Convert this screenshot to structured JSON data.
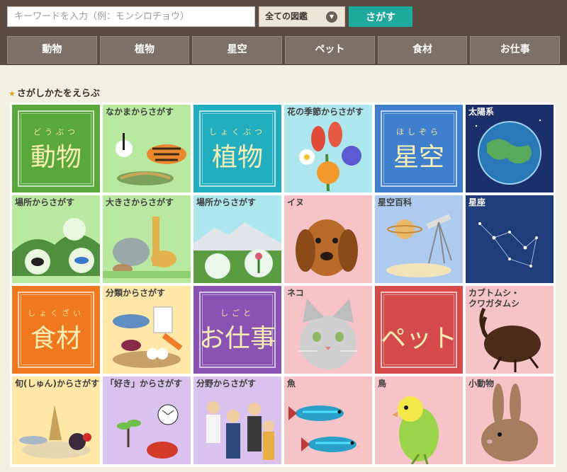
{
  "search": {
    "placeholder": "キーワードを入力（例：モンシロチョウ）",
    "value": ""
  },
  "filter": {
    "selected": "全ての図鑑"
  },
  "search_button": "さがす",
  "nav": [
    "動物",
    "植物",
    "星空",
    "ペット",
    "食材",
    "お仕事"
  ],
  "section_title": "さがしかたをえらぶ",
  "tiles": [
    {
      "kind": "category",
      "ruby": "どうぶつ",
      "title": "動物",
      "bg": "#5aa83c"
    },
    {
      "kind": "topic",
      "label": "なかまからさがす",
      "bg": "#b9e9a0",
      "icon": "animal-group-icon"
    },
    {
      "kind": "category",
      "ruby": "しょくぶつ",
      "title": "植物",
      "bg": "#22aebf"
    },
    {
      "kind": "topic",
      "label": "花の季節からさがす",
      "bg": "#aee6ee",
      "icon": "flower-bouquet-icon"
    },
    {
      "kind": "category",
      "ruby": "ほしぞら",
      "title": "星空",
      "bg": "#3f7fce"
    },
    {
      "kind": "topic",
      "label": "太陽系",
      "bg": "#1b2f6a",
      "icon": "earth-icon"
    },
    {
      "kind": "topic",
      "label": "場所からさがす",
      "bg": "#b9e9a0",
      "icon": "habitat-icon"
    },
    {
      "kind": "topic",
      "label": "大きさからさがす",
      "bg": "#b9e9a0",
      "icon": "animal-size-icon"
    },
    {
      "kind": "topic",
      "label": "場所からさがす",
      "bg": "#aee6ee",
      "icon": "mountain-icon"
    },
    {
      "kind": "topic",
      "label": "イヌ",
      "bg": "#f6c4c6",
      "icon": "dog-icon"
    },
    {
      "kind": "topic",
      "label": "星空百科",
      "bg": "#aecbef",
      "icon": "telescope-icon"
    },
    {
      "kind": "topic",
      "label": "星座",
      "bg": "#1f3d78",
      "icon": "constellation-icon"
    },
    {
      "kind": "category",
      "ruby": "しょくざい",
      "title": "食材",
      "bg": "#f0781e"
    },
    {
      "kind": "topic",
      "label": "分類からさがす",
      "bg": "#ffe7a7",
      "icon": "food-icon"
    },
    {
      "kind": "category",
      "ruby": "しごと",
      "title": "お仕事",
      "bg": "#8a52b2"
    },
    {
      "kind": "topic",
      "label": "ネコ",
      "bg": "#f6c4c6",
      "icon": "cat-icon"
    },
    {
      "kind": "category",
      "ruby": "",
      "title": "ペット",
      "bg": "#d44a4a"
    },
    {
      "kind": "topic",
      "label": "カブトムシ・クワガタムシ",
      "bg": "#f6c4c6",
      "icon": "beetle-icon"
    },
    {
      "kind": "topic",
      "label": "旬(しゅん)からさがす",
      "bg": "#ffe7a7",
      "icon": "seasonal-food-icon"
    },
    {
      "kind": "topic",
      "label": "「好き」からさがす",
      "bg": "#d9c2ee",
      "icon": "hobby-icon"
    },
    {
      "kind": "topic",
      "label": "分野からさがす",
      "bg": "#d9c2ee",
      "icon": "workers-icon"
    },
    {
      "kind": "topic",
      "label": "魚",
      "bg": "#f6c4c6",
      "icon": "fish-icon"
    },
    {
      "kind": "topic",
      "label": "鳥",
      "bg": "#f6c4c6",
      "icon": "bird-icon"
    },
    {
      "kind": "topic",
      "label": "小動物",
      "bg": "#f6c4c6",
      "icon": "rabbit-icon"
    }
  ]
}
